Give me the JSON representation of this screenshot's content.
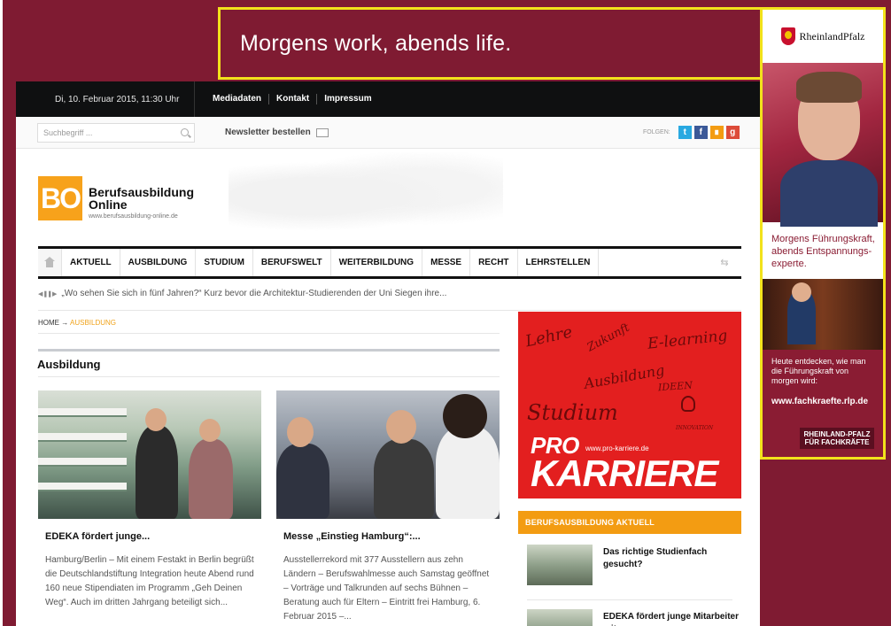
{
  "ad_banner": {
    "text": "Morgens work, abends life."
  },
  "skyscraper": {
    "brand": "RheinlandPfalz",
    "headline": "Morgens Führungskraft, abends Entspannungs-experte.",
    "subline": "Heute entdecken, wie man die Führungskraft von morgen wird:",
    "url": "www.fachkraefte.rlp.de",
    "badge": "RHEINLAND-PFALZ FÜR FACHKRÄFTE"
  },
  "topbar": {
    "date": "Di, 10. Februar 2015, 11:30 Uhr",
    "links": [
      "Mediadaten",
      "Kontakt",
      "Impressum"
    ]
  },
  "search": {
    "placeholder": "Suchbegriff ..."
  },
  "newsletter": {
    "label": "Newsletter bestellen"
  },
  "social": {
    "label": "FOLGEN:",
    "icons": [
      "twitter-icon",
      "facebook-icon",
      "rss-icon",
      "google-plus-icon"
    ],
    "colors": {
      "twitter": "#29a9e1",
      "facebook": "#3b5998",
      "rss": "#f39c12",
      "google_plus": "#dd4b39"
    }
  },
  "logo": {
    "mark": "BO",
    "name": "Berufsausbildung Online",
    "url": "www.berufsausbildung-online.de",
    "color": "#f7a21b"
  },
  "nav": {
    "items": [
      "AKTUELL",
      "AUSBILDUNG",
      "STUDIUM",
      "BERUFSWELT",
      "WEITERBILDUNG",
      "MESSE",
      "RECHT",
      "LEHRSTELLEN"
    ]
  },
  "ticker": {
    "controls": "◀ ❚❚ ▶",
    "text": "„Wo sehen Sie sich in fünf Jahren?“ Kurz bevor die Architektur-Studierenden der Uni Siegen ihre..."
  },
  "breadcrumb": {
    "home": "HOME",
    "separator": "→",
    "current": "AUSBILDUNG"
  },
  "section": {
    "title": "Ausbildung"
  },
  "articles": [
    {
      "title": "EDEKA fördert junge...",
      "text": "Hamburg/Berlin – Mit einem Festakt in Berlin begrüßt die Deutschlandstiftung Integration heute Abend rund 160 neue Stipendiaten im Programm „Geh Deinen Weg“. Auch im dritten Jahrgang beteiligt sich..."
    },
    {
      "title": "Messe „Einstieg Hamburg“:...",
      "text": "Ausstellerrekord mit 377 Ausstellern aus zehn Ländern – Berufswahlmesse auch Samstag geöffnet – Vorträge und Talkrunden auf sechs Bühnen – Beratung auch für Eltern – Eintritt frei Hamburg, 6. Februar 2015 –..."
    }
  ],
  "promo": {
    "words": [
      "Lehre",
      "Zukunft",
      "E-learning",
      "Ausbildung",
      "IDEEN",
      "Studium",
      "INNOVATION"
    ],
    "url": "www.pro-karriere.de",
    "pro": "PRO",
    "karriere": "KARRIERE"
  },
  "aktuell": {
    "heading": "BERUFSAUSBILDUNG AKTUELL",
    "items": [
      "Das richtige Studienfach gesucht?",
      "EDEKA fördert junge Mitarbeiter mit"
    ]
  }
}
